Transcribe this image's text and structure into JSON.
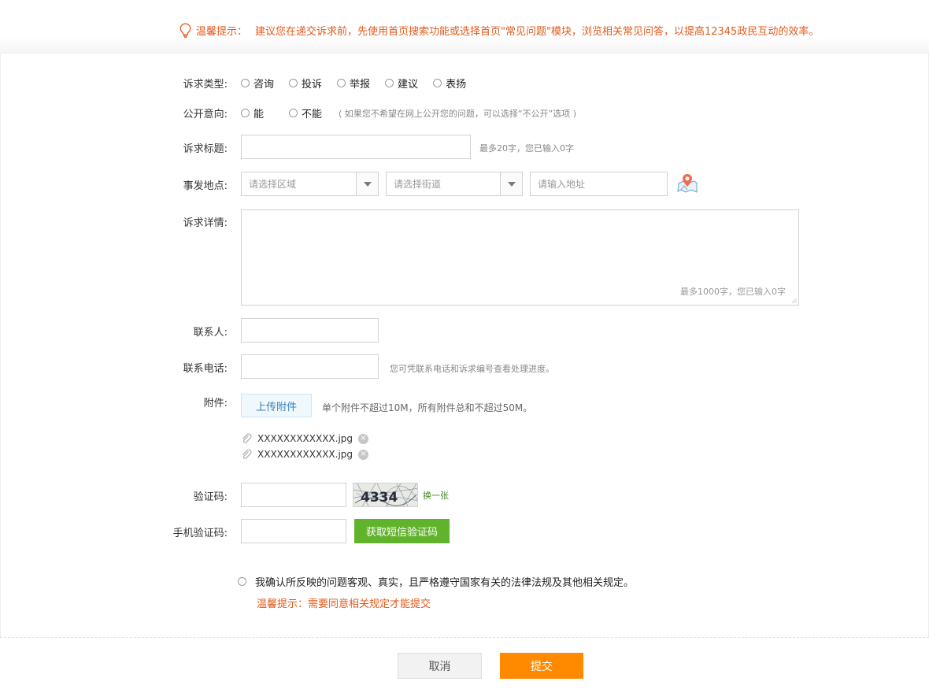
{
  "notice": {
    "label": "温馨提示：",
    "text": "建议您在递交诉求前，先使用首页搜索功能或选择首页\"常见问题\"模块，浏览相关常见问答，以提高12345政民互动的效率。",
    "icon": "lightbulb-icon",
    "color": "#e05b1d"
  },
  "form": {
    "request_type": {
      "label": "诉求类型:",
      "options": [
        "咨询",
        "投诉",
        "举报",
        "建议",
        "表扬"
      ]
    },
    "public_intent": {
      "label": "公开意向:",
      "options": [
        "能",
        "不能"
      ],
      "hint": "( 如果您不希望在网上公开您的问题，可以选择“不公开”选项 )"
    },
    "title": {
      "label": "诉求标题:",
      "value": "",
      "hint": "最多20字，您已输入0字"
    },
    "location": {
      "label": "事发地点:",
      "district_placeholder": "请选择区域",
      "street_placeholder": "请选择街道",
      "address_placeholder": "请输入地址",
      "map_icon": "map-pin-icon"
    },
    "details": {
      "label": "诉求详情:",
      "value": "",
      "counter": "最多1000字，您已输入0字"
    },
    "contact": {
      "label": "联系人:",
      "value": ""
    },
    "phone": {
      "label": "联系电话:",
      "value": "",
      "hint": "您可凭联系电话和诉求编号查看处理进度。"
    },
    "attachments": {
      "label": "附件:",
      "upload_label": "上传附件",
      "hint": "单个附件不超过10M，所有附件总和不超过50M。",
      "files": [
        {
          "name": "XXXXXXXXXXXX.jpg"
        },
        {
          "name": "XXXXXXXXXXXX.jpg"
        }
      ]
    },
    "captcha": {
      "label": "验证码:",
      "value": "",
      "image_text": "4334",
      "refresh_label": "换一张"
    },
    "sms_code": {
      "label": "手机验证码:",
      "value": "",
      "button_label": "获取短信验证码"
    },
    "agreement": {
      "text": "我确认所反映的问题客观、真实，且严格遵守国家有关的法律法规及其他相关规定。",
      "tip": "温馨提示：需要同意相关规定才能提交"
    }
  },
  "footer": {
    "cancel_label": "取消",
    "submit_label": "提交"
  },
  "colors": {
    "accent_orange": "#ff8a00",
    "accent_green": "#62b32c",
    "warning_text": "#e05b1d",
    "upload_text": "#3b7fb5"
  }
}
